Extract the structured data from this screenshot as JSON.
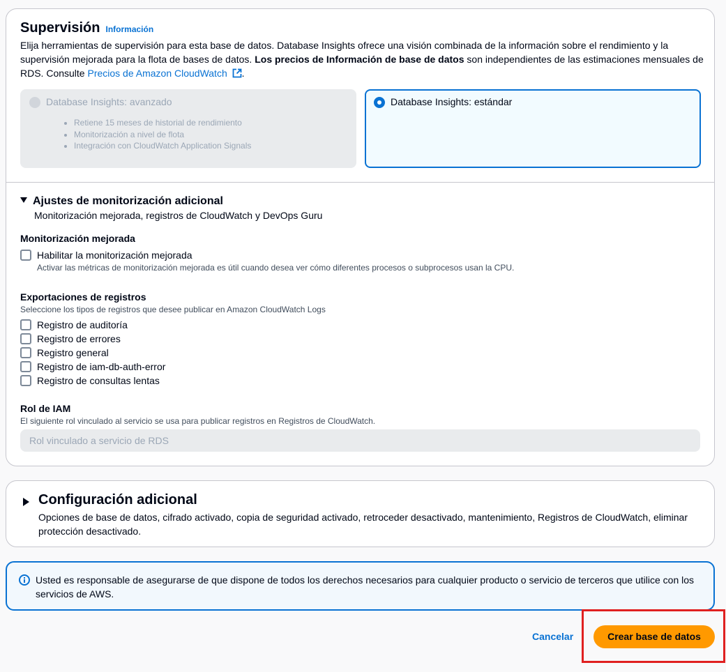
{
  "monitoring": {
    "title": "Supervisión",
    "info_link": "Información",
    "description_1": "Elija herramientas de supervisión para esta base de datos. Database Insights ofrece una visión combinada de la información sobre el rendimiento y la supervisión mejorada para la flota de bases de datos. ",
    "description_bold": "Los precios de Información de base de datos",
    "description_2": " son independientes de las estimaciones mensuales de RDS. Consulte ",
    "pricing_link": "Precios de Amazon CloudWatch",
    "description_end": ".",
    "tiles": [
      {
        "label": "Database Insights: avanzado",
        "selected": false,
        "disabled": true,
        "bullets": [
          "Retiene 15 meses de historial de rendimiento",
          "Monitorización a nivel de flota",
          "Integración con CloudWatch Application Signals"
        ]
      },
      {
        "label": "Database Insights: estándar",
        "selected": true,
        "disabled": false
      }
    ]
  },
  "additional_monitoring": {
    "title": "Ajustes de monitorización adicional",
    "subtitle": "Monitorización mejorada, registros de CloudWatch y DevOps Guru",
    "enhanced": {
      "label": "Monitorización mejorada",
      "checkbox_label": "Habilitar la monitorización mejorada",
      "checked": false,
      "hint": "Activar las métricas de monitorización mejorada es útil cuando desea ver cómo diferentes procesos o subprocesos usan la CPU."
    },
    "log_exports": {
      "label": "Exportaciones de registros",
      "hint": "Seleccione los tipos de registros que desee publicar en Amazon CloudWatch Logs",
      "items": [
        {
          "label": "Registro de auditoría",
          "checked": false
        },
        {
          "label": "Registro de errores",
          "checked": false
        },
        {
          "label": "Registro general",
          "checked": false
        },
        {
          "label": "Registro de iam-db-auth-error",
          "checked": false
        },
        {
          "label": "Registro de consultas lentas",
          "checked": false
        }
      ]
    },
    "iam_role": {
      "label": "Rol de IAM",
      "hint": "El siguiente rol vinculado al servicio se usa para publicar registros en Registros de CloudWatch.",
      "placeholder": "Rol vinculado a servicio de RDS"
    }
  },
  "additional_config": {
    "title": "Configuración adicional",
    "description": "Opciones de base de datos, cifrado activado, copia de seguridad activado, retroceder desactivado, mantenimiento, Registros de CloudWatch, eliminar protección desactivado."
  },
  "alert": {
    "icon": "info-circle-icon",
    "text": "Usted es responsable de asegurarse de que dispone de todos los derechos necesarios para cualquier producto o servicio de terceros que utilice con los servicios de AWS."
  },
  "actions": {
    "cancel": "Cancelar",
    "create": "Crear base de datos"
  },
  "colors": {
    "accent": "#0972d3",
    "primary_button": "#ff9900",
    "highlight": "#e02020"
  }
}
